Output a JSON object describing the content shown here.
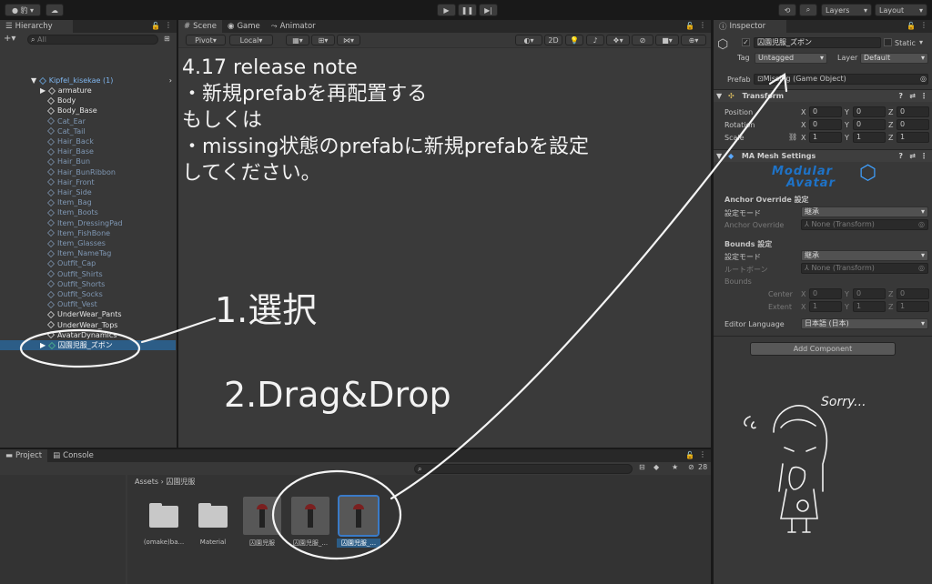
{
  "toolbar": {
    "account_label": "豹",
    "layers_label": "Layers",
    "layout_label": "Layout"
  },
  "hierarchy": {
    "tab_label": "Hierarchy",
    "search_placeholder": "All",
    "root": "Kipfel_kisekae (1)",
    "items": [
      {
        "label": "armature",
        "active": true
      },
      {
        "label": "Body",
        "active": true
      },
      {
        "label": "Body_Base",
        "active": true
      },
      {
        "label": "Cat_Ear",
        "active": false
      },
      {
        "label": "Cat_Tail",
        "active": false
      },
      {
        "label": "Hair_Back",
        "active": false
      },
      {
        "label": "Hair_Base",
        "active": false
      },
      {
        "label": "Hair_Bun",
        "active": false
      },
      {
        "label": "Hair_BunRibbon",
        "active": false
      },
      {
        "label": "Hair_Front",
        "active": false
      },
      {
        "label": "Hair_Side",
        "active": false
      },
      {
        "label": "Item_Bag",
        "active": false
      },
      {
        "label": "Item_Boots",
        "active": false
      },
      {
        "label": "Item_DressingPad",
        "active": false
      },
      {
        "label": "Item_FishBone",
        "active": false
      },
      {
        "label": "Item_Glasses",
        "active": false
      },
      {
        "label": "Item_NameTag",
        "active": false
      },
      {
        "label": "Outfit_Cap",
        "active": false
      },
      {
        "label": "Outfit_Shirts",
        "active": false
      },
      {
        "label": "Outfit_Shorts",
        "active": false
      },
      {
        "label": "Outfit_Socks",
        "active": false
      },
      {
        "label": "Outfit_Vest",
        "active": false
      },
      {
        "label": "UnderWear_Pants",
        "active": true
      },
      {
        "label": "UnderWear_Tops",
        "active": true
      },
      {
        "label": "AvatarDynamics",
        "active": true
      }
    ],
    "selected": "囚園児服_ズボン"
  },
  "scene": {
    "tabs": {
      "scene": "Scene",
      "game": "Game",
      "animator": "Animator"
    },
    "pivot": "Pivot",
    "local": "Local",
    "mode_2d": "2D",
    "note_lines": [
      "4.17 release note",
      "・新規prefabを再配置する",
      "もしくは",
      "・missing状態のprefabに新規prefabを設定",
      "してください。"
    ],
    "step1": "1.選択",
    "step2": "2.Drag&Drop"
  },
  "inspector": {
    "tab_label": "Inspector",
    "object_name": "囚園児服_ズボン",
    "static_label": "Static",
    "tag_label": "Tag",
    "tag_value": "Untagged",
    "layer_label": "Layer",
    "layer_value": "Default",
    "prefab_label": "Prefab",
    "prefab_value": "Missing (Game Object)",
    "transform": {
      "title": "Transform",
      "rows": [
        {
          "label": "Position",
          "x": "0",
          "y": "0",
          "z": "0"
        },
        {
          "label": "Rotation",
          "x": "0",
          "y": "0",
          "z": "0"
        },
        {
          "label": "Scale",
          "x": "1",
          "y": "1",
          "z": "1"
        }
      ]
    },
    "ma": {
      "title": "MA Mesh Settings",
      "logo_top": "Modular",
      "logo_bottom": "Avatar",
      "anchor_header": "Anchor Override 設定",
      "setting_mode_label": "設定モード",
      "setting_mode_value": "継承",
      "anchor_override_label": "Anchor Override",
      "anchor_override_value": "None (Transform)",
      "bounds_header": "Bounds 設定",
      "bounds_mode_label": "設定モード",
      "bounds_mode_value": "継承",
      "root_bone_label": "ルートボーン",
      "root_bone_value": "None (Transform)",
      "bounds_label": "Bounds",
      "center_label": "Center",
      "center": {
        "x": "0",
        "y": "0",
        "z": "0"
      },
      "extent_label": "Extent",
      "extent": {
        "x": "1",
        "y": "1",
        "z": "1"
      },
      "editor_lang_label": "Editor Language",
      "editor_lang_value": "日本語 (日本)"
    },
    "add_component": "Add Component",
    "sorry_text": "Sorry..."
  },
  "project": {
    "tabs": {
      "project": "Project",
      "console": "Console"
    },
    "hidden_count": "28",
    "breadcrumb": [
      "Assets",
      "囚園児服"
    ],
    "assets": [
      {
        "label": "(omake)ba...",
        "kind": "folder"
      },
      {
        "label": "Material",
        "kind": "folder"
      },
      {
        "label": "囚園児服",
        "kind": "prefab"
      },
      {
        "label": "囚園児服_...",
        "kind": "prefab"
      },
      {
        "label": "囚園児服_...",
        "kind": "prefab-selected"
      }
    ]
  }
}
